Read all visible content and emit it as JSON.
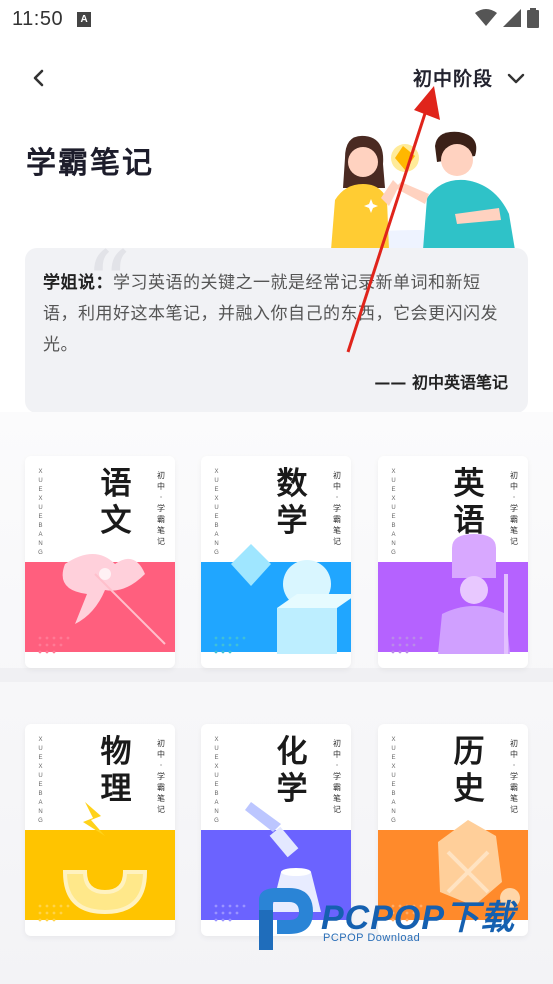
{
  "status_bar": {
    "time": "11:50",
    "notif_glyph": "A"
  },
  "nav": {
    "back_icon": "chevron-left-icon",
    "stage": "初中阶段",
    "stage_icon": "chevron-down-icon"
  },
  "title": "学霸笔记",
  "quote": {
    "speaker": "学姐说：",
    "body": "学习英语的关键之一就是经常记录新单词和新短语，利用好这本笔记，并融入你自己的东西，它会更闪闪发光。",
    "signature": "—— 初中英语笔记",
    "mark": "“"
  },
  "notebooks": [
    {
      "subject": "语文",
      "side": "初中·学霸笔记",
      "vertical": "XUEXUEBANG",
      "color": "#ff5f7e"
    },
    {
      "subject": "数学",
      "side": "初中·学霸笔记",
      "vertical": "XUEXUEBANG",
      "color": "#20a6ff"
    },
    {
      "subject": "英语",
      "side": "初中·学霸笔记",
      "vertical": "XUEXUEBANG",
      "color": "#b562ff"
    },
    {
      "subject": "物理",
      "side": "初中·学霸笔记",
      "vertical": "XUEXUEBANG",
      "color": "#ffc400"
    },
    {
      "subject": "化学",
      "side": "初中·学霸笔记",
      "vertical": "XUEXUEBANG",
      "color": "#6b63ff"
    },
    {
      "subject": "历史",
      "side": "初中·学霸笔记",
      "vertical": "XUEXUEBANG",
      "color": "#ff8a2b"
    }
  ],
  "watermark": {
    "brand": "PCPOP下载",
    "sub": "PCPOP Download"
  }
}
